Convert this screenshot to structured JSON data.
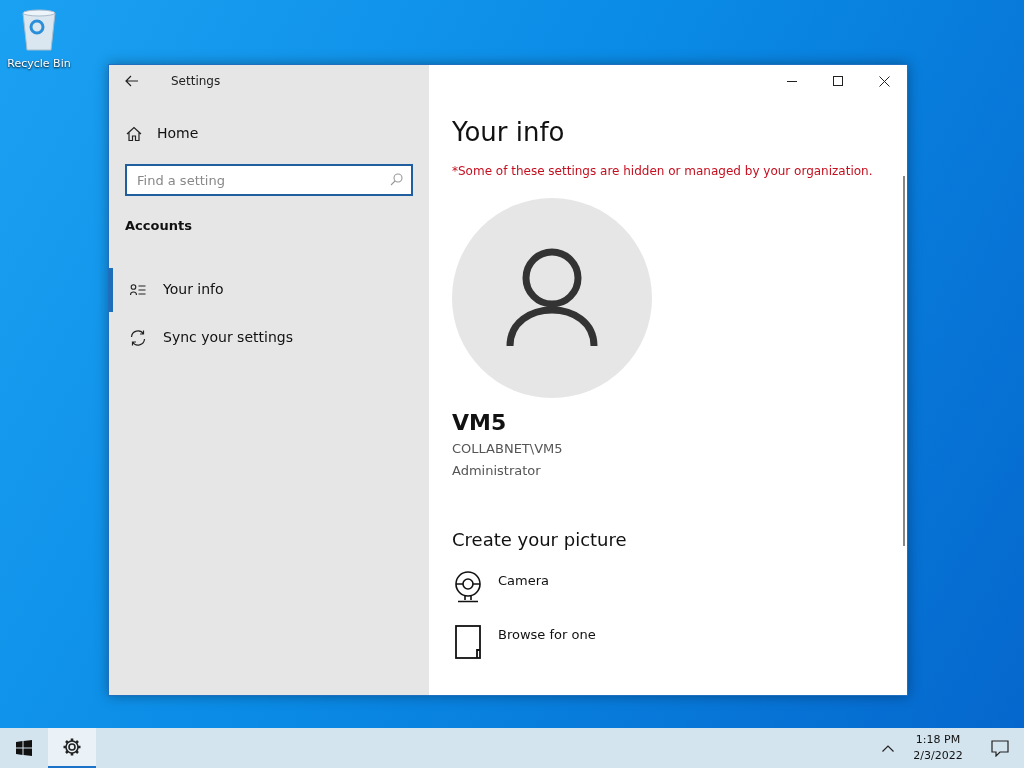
{
  "desktop": {
    "icons": [
      {
        "label": "Recycle Bin"
      }
    ]
  },
  "window": {
    "title": "Settings",
    "nav": {
      "home": "Home",
      "search_placeholder": "Find a setting",
      "section": "Accounts",
      "items": [
        {
          "label": "Your info",
          "kind": "person",
          "selected": true
        },
        {
          "label": "Sync your settings",
          "kind": "sync",
          "selected": false
        }
      ]
    },
    "content": {
      "heading": "Your info",
      "notice": "*Some of these settings are hidden or managed by your organization.",
      "account": {
        "name": "VM5",
        "domain": "COLLABNET\\VM5",
        "role": "Administrator"
      },
      "picture_section": {
        "heading": "Create your picture",
        "options": [
          {
            "label": "Camera",
            "kind": "camera"
          },
          {
            "label": "Browse for one",
            "kind": "browse"
          }
        ]
      }
    }
  },
  "taskbar": {
    "apps": [
      {
        "kind": "settings",
        "selected": true
      }
    ],
    "time": "1:18 PM",
    "date": "2/3/2022"
  }
}
